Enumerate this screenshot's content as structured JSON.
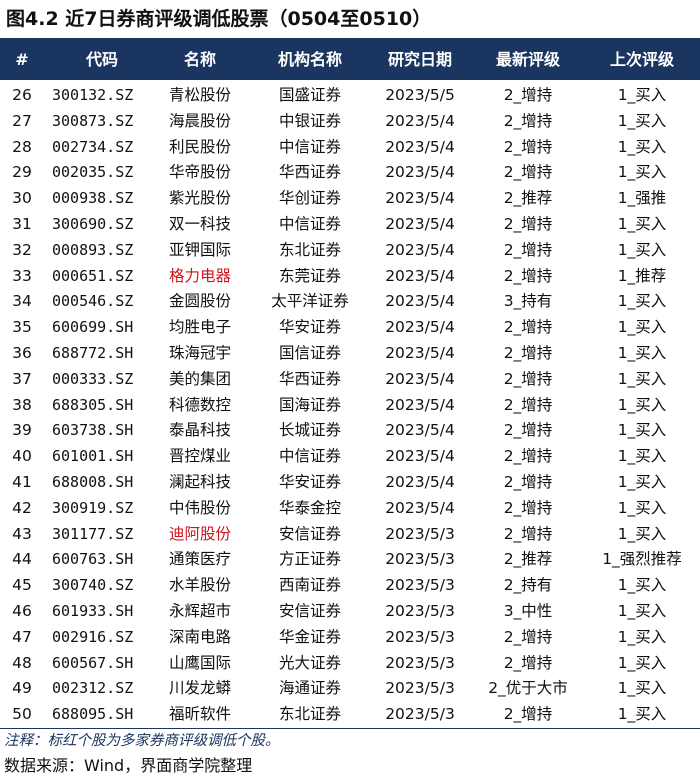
{
  "title": "图4.2 近7日券商评级调低股票（0504至0510）",
  "columns": {
    "num": "#",
    "code": "代码",
    "name": "名称",
    "institution": "机构名称",
    "date": "研究日期",
    "new_rating": "最新评级",
    "prev_rating": "上次评级"
  },
  "colors": {
    "header_bg": "#1a3560",
    "highlight": "#d0141c"
  },
  "rows": [
    {
      "num": "26",
      "code": "300132.SZ",
      "name": "青松股份",
      "institution": "国盛证券",
      "date": "2023/5/5",
      "new": "2_增持",
      "old": "1_买入",
      "highlight": false
    },
    {
      "num": "27",
      "code": "300873.SZ",
      "name": "海晨股份",
      "institution": "中银证券",
      "date": "2023/5/4",
      "new": "2_增持",
      "old": "1_买入",
      "highlight": false
    },
    {
      "num": "28",
      "code": "002734.SZ",
      "name": "利民股份",
      "institution": "中信证券",
      "date": "2023/5/4",
      "new": "2_增持",
      "old": "1_买入",
      "highlight": false
    },
    {
      "num": "29",
      "code": "002035.SZ",
      "name": "华帝股份",
      "institution": "华西证券",
      "date": "2023/5/4",
      "new": "2_增持",
      "old": "1_买入",
      "highlight": false
    },
    {
      "num": "30",
      "code": "000938.SZ",
      "name": "紫光股份",
      "institution": "华创证券",
      "date": "2023/5/4",
      "new": "2_推荐",
      "old": "1_强推",
      "highlight": false
    },
    {
      "num": "31",
      "code": "300690.SZ",
      "name": "双一科技",
      "institution": "中信证券",
      "date": "2023/5/4",
      "new": "2_增持",
      "old": "1_买入",
      "highlight": false
    },
    {
      "num": "32",
      "code": "000893.SZ",
      "name": "亚钾国际",
      "institution": "东北证券",
      "date": "2023/5/4",
      "new": "2_增持",
      "old": "1_买入",
      "highlight": false
    },
    {
      "num": "33",
      "code": "000651.SZ",
      "name": "格力电器",
      "institution": "东莞证券",
      "date": "2023/5/4",
      "new": "2_增持",
      "old": "1_推荐",
      "highlight": true
    },
    {
      "num": "34",
      "code": "000546.SZ",
      "name": "金圆股份",
      "institution": "太平洋证券",
      "date": "2023/5/4",
      "new": "3_持有",
      "old": "1_买入",
      "highlight": false
    },
    {
      "num": "35",
      "code": "600699.SH",
      "name": "均胜电子",
      "institution": "华安证券",
      "date": "2023/5/4",
      "new": "2_增持",
      "old": "1_买入",
      "highlight": false
    },
    {
      "num": "36",
      "code": "688772.SH",
      "name": "珠海冠宇",
      "institution": "国信证券",
      "date": "2023/5/4",
      "new": "2_增持",
      "old": "1_买入",
      "highlight": false
    },
    {
      "num": "37",
      "code": "000333.SZ",
      "name": "美的集团",
      "institution": "华西证券",
      "date": "2023/5/4",
      "new": "2_增持",
      "old": "1_买入",
      "highlight": false
    },
    {
      "num": "38",
      "code": "688305.SH",
      "name": "科德数控",
      "institution": "国海证券",
      "date": "2023/5/4",
      "new": "2_增持",
      "old": "1_买入",
      "highlight": false
    },
    {
      "num": "39",
      "code": "603738.SH",
      "name": "泰晶科技",
      "institution": "长城证券",
      "date": "2023/5/4",
      "new": "2_增持",
      "old": "1_买入",
      "highlight": false
    },
    {
      "num": "40",
      "code": "601001.SH",
      "name": "晋控煤业",
      "institution": "中信证券",
      "date": "2023/5/4",
      "new": "2_增持",
      "old": "1_买入",
      "highlight": false
    },
    {
      "num": "41",
      "code": "688008.SH",
      "name": "澜起科技",
      "institution": "华安证券",
      "date": "2023/5/4",
      "new": "2_增持",
      "old": "1_买入",
      "highlight": false
    },
    {
      "num": "42",
      "code": "300919.SZ",
      "name": "中伟股份",
      "institution": "华泰金控",
      "date": "2023/5/4",
      "new": "2_增持",
      "old": "1_买入",
      "highlight": false
    },
    {
      "num": "43",
      "code": "301177.SZ",
      "name": "迪阿股份",
      "institution": "安信证券",
      "date": "2023/5/3",
      "new": "2_增持",
      "old": "1_买入",
      "highlight": true
    },
    {
      "num": "44",
      "code": "600763.SH",
      "name": "通策医疗",
      "institution": "方正证券",
      "date": "2023/5/3",
      "new": "2_推荐",
      "old": "1_强烈推荐",
      "highlight": false
    },
    {
      "num": "45",
      "code": "300740.SZ",
      "name": "水羊股份",
      "institution": "西南证券",
      "date": "2023/5/3",
      "new": "2_持有",
      "old": "1_买入",
      "highlight": false
    },
    {
      "num": "46",
      "code": "601933.SH",
      "name": "永辉超市",
      "institution": "安信证券",
      "date": "2023/5/3",
      "new": "3_中性",
      "old": "1_买入",
      "highlight": false
    },
    {
      "num": "47",
      "code": "002916.SZ",
      "name": "深南电路",
      "institution": "华金证券",
      "date": "2023/5/3",
      "new": "2_增持",
      "old": "1_买入",
      "highlight": false
    },
    {
      "num": "48",
      "code": "600567.SH",
      "name": "山鹰国际",
      "institution": "光大证券",
      "date": "2023/5/3",
      "new": "2_增持",
      "old": "1_买入",
      "highlight": false
    },
    {
      "num": "49",
      "code": "002312.SZ",
      "name": "川发龙蟒",
      "institution": "海通证券",
      "date": "2023/5/3",
      "new": "2_优于大市",
      "old": "1_买入",
      "highlight": false
    },
    {
      "num": "50",
      "code": "688095.SH",
      "name": "福昕软件",
      "institution": "东北证券",
      "date": "2023/5/3",
      "new": "2_增持",
      "old": "1_买入",
      "highlight": false
    }
  ],
  "note": "注释：标红个股为多家券商评级调低个股。",
  "source": "数据来源：Wind，界面商学院整理"
}
